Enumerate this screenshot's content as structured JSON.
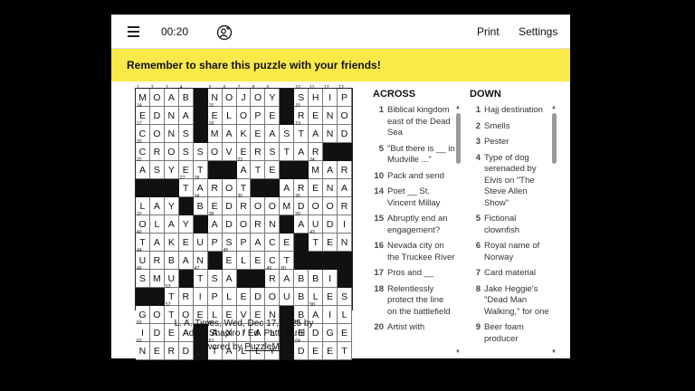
{
  "header": {
    "timer": "00:20",
    "print_label": "Print",
    "settings_label": "Settings"
  },
  "banner": {
    "text": "Remember to share this puzzle with your friends!"
  },
  "grid": {
    "rows": [
      "MOAB#NOJOY#SHIP",
      "EDNA#ELOPE#RENO",
      "CONS#MAKEASTAND",
      "CROSSOVERSTAR##",
      "ASYET##ATE##MAR",
      "###TAROT##ARENA",
      "LAY#BEDROOMDOOR",
      "OLAY#ADORN#AUDI",
      "TAKEUPSPACE#TEN",
      "URBAN#ELECT####",
      "SMU#TSA##RABBI",
      "##TRIPLEDOUBLES",
      "GOTOELEVEN#BAIL",
      "IDEA#AXIAL#EDGE",
      "NERD#TALLY#DEET"
    ],
    "numbers": {
      "0,0": "1",
      "0,1": "2",
      "0,2": "3",
      "0,3": "4",
      "0,5": "5",
      "0,6": "6",
      "0,7": "7",
      "0,8": "8",
      "0,9": "9",
      "0,11": "10",
      "0,12": "11",
      "0,13": "12",
      "0,14": "13",
      "1,0": "14",
      "1,5": "15",
      "1,11": "16",
      "2,0": "17",
      "2,5": "18",
      "2,11": "19",
      "3,0": "20",
      "3,4": "21",
      "4,0": "22",
      "4,7": "23",
      "4,12": "24",
      "4,13": "25",
      "4,14": "26",
      "5,3": "27",
      "5,4": "28",
      "5,9": "29",
      "5,10": "30",
      "6,0": "31",
      "6,1": "32",
      "6,2": "33",
      "6,4": "34",
      "6,7": "35",
      "6,11": "36",
      "7,0": "37",
      "7,5": "38",
      "7,11": "39",
      "8,0": "40",
      "8,4": "41",
      "8,10": "42",
      "8,12": "43",
      "9,0": "44",
      "9,6": "45",
      "10,0": "46",
      "10,4": "47",
      "10,5": "48",
      "10,9": "49",
      "10,10": "50",
      "10,11": "51",
      "10,12": "52",
      "11,2": "53",
      "11,8": "54",
      "12,0": "55",
      "12,1": "56",
      "12,2": "57",
      "12,12": "58",
      "13,0": "59",
      "13,5": "60",
      "13,11": "61",
      "14,0": "62",
      "14,5": "63",
      "14,11": "64"
    }
  },
  "credit": {
    "line1": "L. A. Times, Wed, Dec 17, 2025 by",
    "line2": "Adam Shapiro / Ed. Patti Varol",
    "powered_prefix": "Powered by ",
    "powered_link": "PuzzleMe™"
  },
  "across": {
    "heading": "ACROSS",
    "clues": [
      {
        "n": "1",
        "t": "Biblical kingdom east of the Dead Sea"
      },
      {
        "n": "5",
        "t": "\"But there is __ in Mudville ...\""
      },
      {
        "n": "10",
        "t": "Pack and send"
      },
      {
        "n": "14",
        "t": "Poet __ St. Vincent Millay"
      },
      {
        "n": "15",
        "t": "Abruptly end an engagement?"
      },
      {
        "n": "16",
        "t": "Nevada city on the Truckee River"
      },
      {
        "n": "17",
        "t": "Pros and __"
      },
      {
        "n": "18",
        "t": "Relentlessly protect the line on the battlefield"
      },
      {
        "n": "20",
        "t": "Artist with"
      }
    ]
  },
  "down": {
    "heading": "DOWN",
    "clues": [
      {
        "n": "1",
        "t": "Hajj destination"
      },
      {
        "n": "2",
        "t": "Smells"
      },
      {
        "n": "3",
        "t": "Pester"
      },
      {
        "n": "4",
        "t": "Type of dog serenaded by Elvis on \"The Steve Allen Show\""
      },
      {
        "n": "5",
        "t": "Fictional clownfish"
      },
      {
        "n": "6",
        "t": "Royal name of Norway"
      },
      {
        "n": "7",
        "t": "Card material"
      },
      {
        "n": "8",
        "t": "Jake Heggie's \"Dead Man Walking,\" for one"
      },
      {
        "n": "9",
        "t": "Beer foam producer"
      }
    ]
  }
}
